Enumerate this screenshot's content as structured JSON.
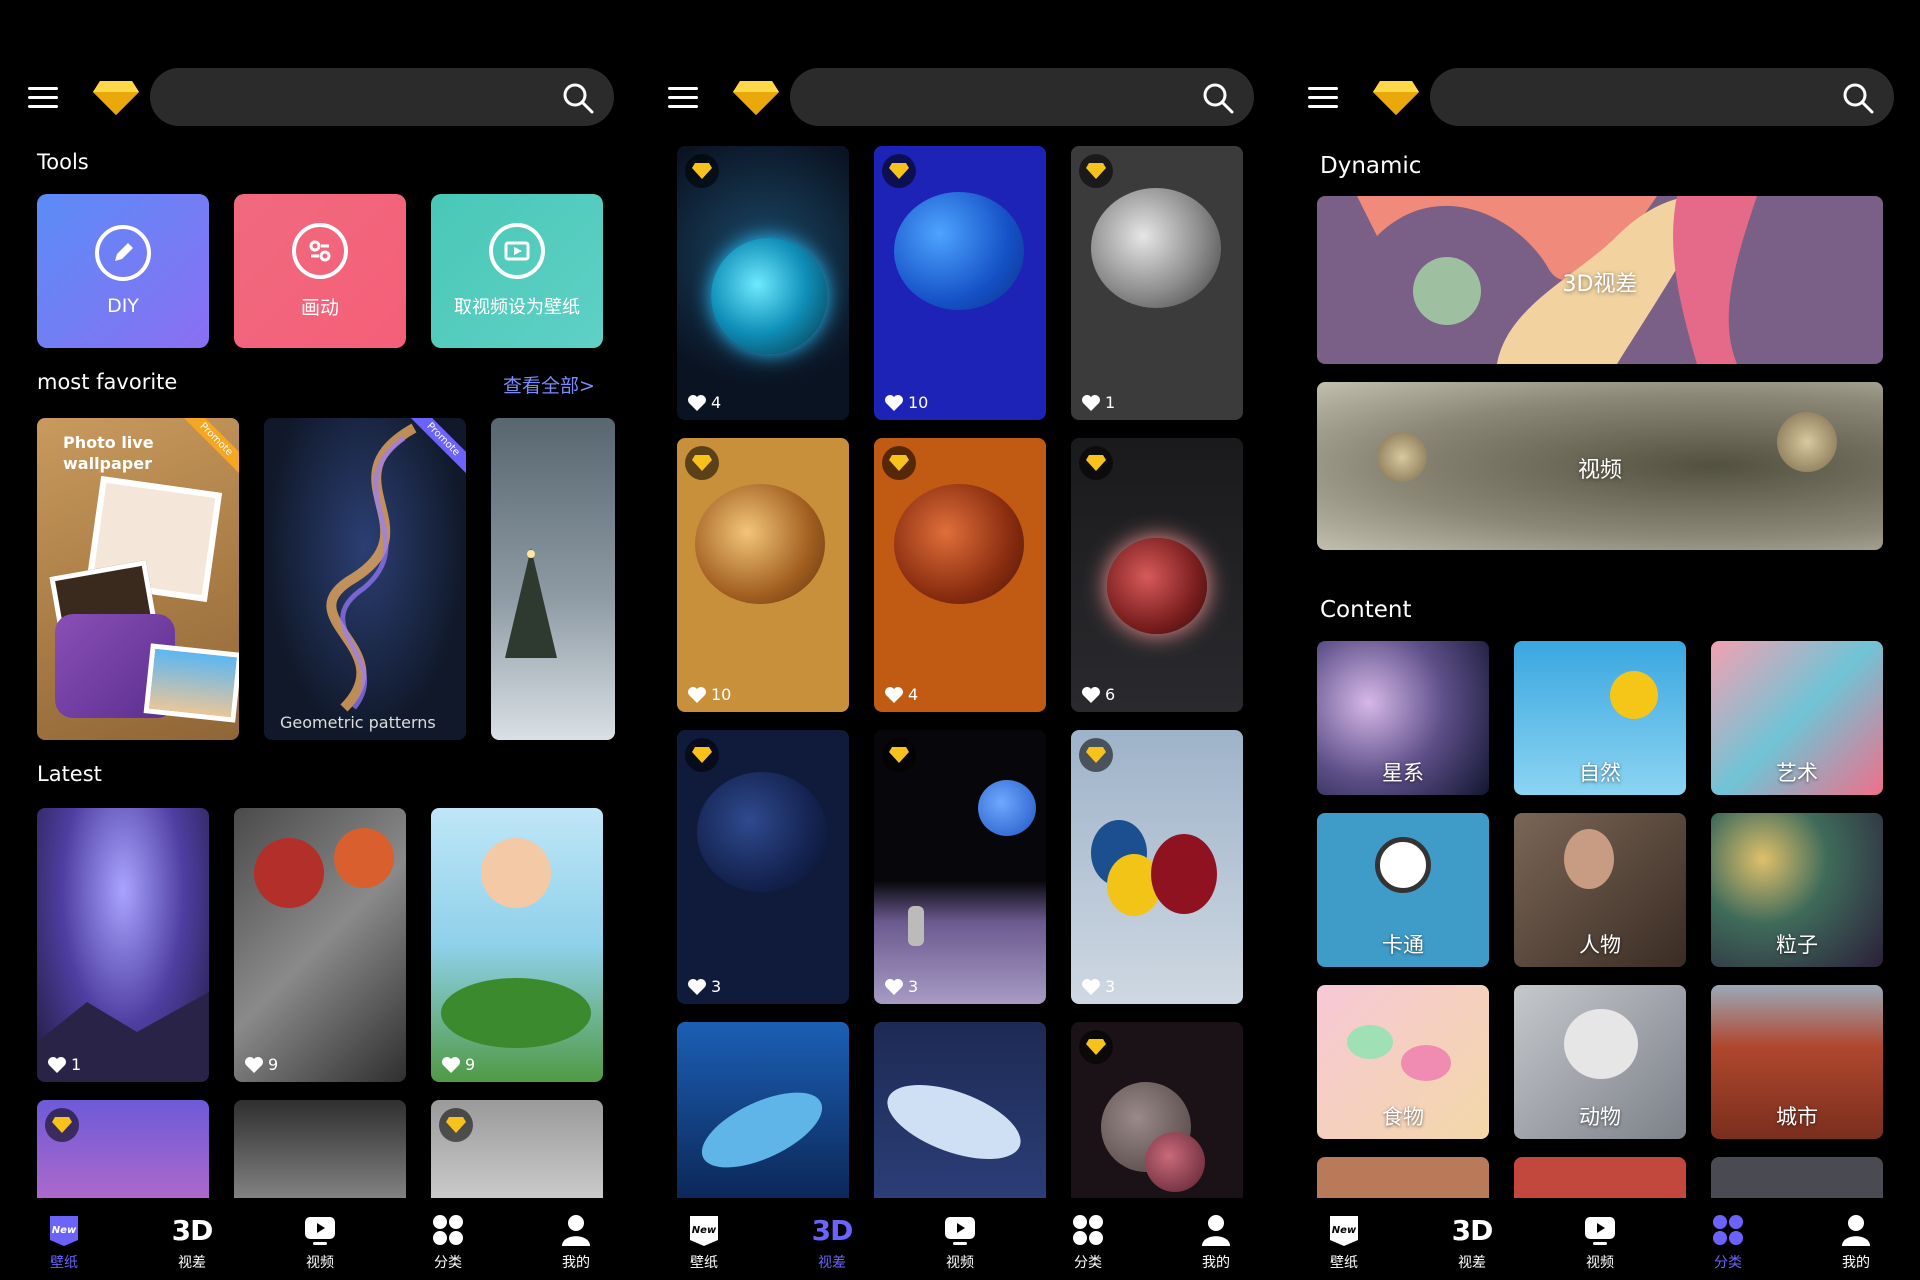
{
  "search": {
    "placeholder": ""
  },
  "panel1": {
    "tools_title": "Tools",
    "tools": [
      {
        "label": "DIY",
        "color_from": "#5b8cf7",
        "color_to": "#8a6ff2"
      },
      {
        "label": "画动",
        "color_from": "#f06a7f",
        "color_to": "#f55f78"
      },
      {
        "label": "取视频设为壁纸",
        "color_from": "#49c8b6",
        "color_to": "#5fd0c6"
      }
    ],
    "favorite_title": "most favorite",
    "view_all": "查看全部>",
    "favorites": [
      {
        "title": "Photo live wallpaper",
        "badge": "Promote"
      },
      {
        "title": "Geometric patterns",
        "badge": "Promote"
      }
    ],
    "latest_title": "Latest",
    "latest_likes": [
      "1",
      "9",
      "9"
    ]
  },
  "panel2": {
    "likes": [
      "4",
      "10",
      "1",
      "10",
      "4",
      "6",
      "3",
      "3",
      "3"
    ]
  },
  "panel3": {
    "dynamic_title": "Dynamic",
    "dynamic": [
      "3D视差",
      "视频"
    ],
    "content_title": "Content",
    "categories": [
      "星系",
      "自然",
      "艺术",
      "卡通",
      "人物",
      "粒子",
      "食物",
      "动物",
      "城市"
    ]
  },
  "nav": [
    {
      "label": "壁纸",
      "icon": "wallpaper-icon"
    },
    {
      "label": "视差",
      "icon": "3d-icon",
      "icon_text": "3D"
    },
    {
      "label": "视频",
      "icon": "video-icon"
    },
    {
      "label": "分类",
      "icon": "category-icon"
    },
    {
      "label": "我的",
      "icon": "profile-icon"
    }
  ],
  "active_tab": {
    "panel1": "壁纸",
    "panel2": "视差",
    "panel3": "分类"
  },
  "colors": {
    "accent": "#6c63ff",
    "search_bg": "#2b2b2b",
    "gem": "#f7c21c",
    "link": "#7b8cff"
  }
}
